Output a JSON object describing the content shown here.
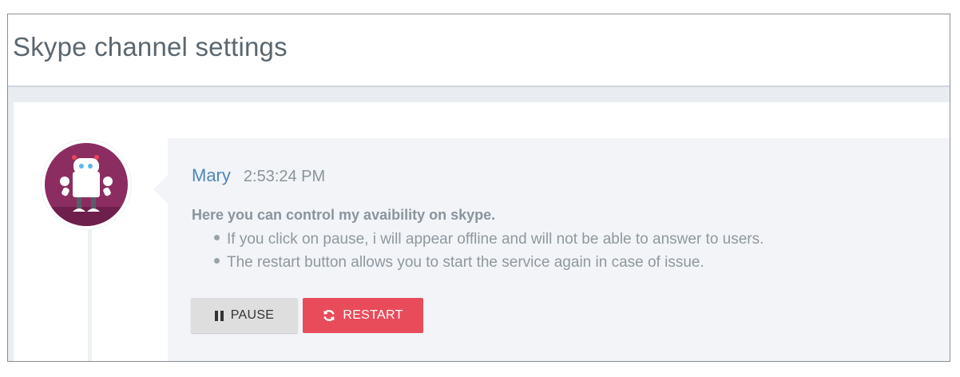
{
  "header": {
    "title": "Skype channel settings"
  },
  "message": {
    "author": "Mary",
    "time": "2:53:24 PM",
    "intro": "Here you can control my avaibility on skype.",
    "bullets": [
      "If you click on pause, i will appear offline and will not be able to answer to users.",
      "The restart button allows you to start the service again in case of issue."
    ]
  },
  "buttons": {
    "pause_label": "PAUSE",
    "pause_icon": "pause-icon",
    "restart_label": "RESTART",
    "restart_icon": "refresh-icon"
  },
  "colors": {
    "author": "#4f87b8",
    "restart": "#e84c5b",
    "avatar_bg": "#8c2d62"
  }
}
